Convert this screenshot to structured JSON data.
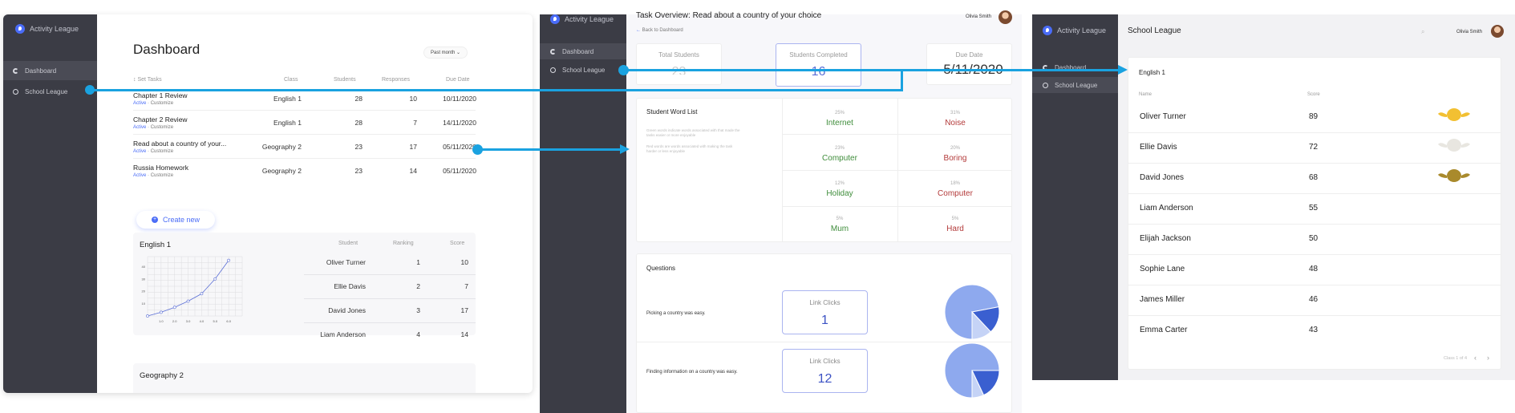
{
  "colors": {
    "accent": "#4a6cf7",
    "sidebar": "#3b3c45",
    "connector": "#1aa2e0",
    "good": "#3f8d3b",
    "bad": "#b33a3a"
  },
  "app": {
    "title": "Activity League"
  },
  "nav": {
    "dashboard": "Dashboard",
    "school_league": "School League"
  },
  "dashboard": {
    "title": "Dashboard",
    "filter": "Past month",
    "columns": {
      "tasks": "Set Tasks",
      "class": "Class",
      "students": "Students",
      "responses": "Responses",
      "due": "Due Date"
    },
    "tasks": [
      {
        "title": "Chapter 1 Review",
        "status": "Active",
        "action": "Customize",
        "class": "English 1",
        "students": "28",
        "responses": "10",
        "due": "10/11/2020"
      },
      {
        "title": "Chapter 2 Review",
        "status": "Active",
        "action": "Customize",
        "class": "English 1",
        "students": "28",
        "responses": "7",
        "due": "14/11/2020"
      },
      {
        "title": "Read about a country of your...",
        "status": "Active",
        "action": "Customize",
        "class": "Geography 2",
        "students": "23",
        "responses": "17",
        "due": "05/11/2020"
      },
      {
        "title": "Russia Homework",
        "status": "Active",
        "action": "Customize",
        "class": "Geography 2",
        "students": "23",
        "responses": "14",
        "due": "05/11/2020"
      }
    ],
    "create_new": "Create new",
    "english_card": {
      "title": "English 1",
      "columns": {
        "student": "Student",
        "ranking": "Ranking",
        "score": "Score"
      },
      "rows": [
        {
          "student": "Oliver Turner",
          "ranking": "1",
          "score": "10"
        },
        {
          "student": "Ellie Davis",
          "ranking": "2",
          "score": "7"
        },
        {
          "student": "David Jones",
          "ranking": "3",
          "score": "17"
        },
        {
          "student": "Liam Anderson",
          "ranking": "4",
          "score": "14"
        }
      ],
      "chart": {
        "x_ticks": [
          "1.0",
          "2.0",
          "3.0",
          "4.0",
          "5.0",
          "6.0"
        ],
        "y_ticks": [
          "10",
          "20",
          "30",
          "40"
        ],
        "points": [
          [
            0,
            0
          ],
          [
            1,
            3
          ],
          [
            2,
            7
          ],
          [
            3,
            12
          ],
          [
            4,
            18
          ],
          [
            5,
            30
          ],
          [
            6,
            45
          ]
        ],
        "xlim": [
          0,
          7
        ],
        "ylim": [
          0,
          48
        ]
      }
    },
    "geography_card": {
      "title": "Geography 2"
    }
  },
  "task_overview": {
    "title": "Task Overview: Read about a country of your choice",
    "back": "Back to Dashboard",
    "user": "Olivia Smith",
    "stats": [
      {
        "label": "Total Students",
        "value": "23"
      },
      {
        "label": "Students Completed",
        "value": "16"
      },
      {
        "label": "Due Date",
        "value": "5/11/2020"
      }
    ],
    "word_list": {
      "title": "Student Word List",
      "desc1": "Green words indicate words associated with that made the tasks easier or more enjoyable",
      "desc2": "Red words are words associated with making the task harder or less enjoyable",
      "good": [
        {
          "pct": "25%",
          "word": "Internet"
        },
        {
          "pct": "23%",
          "word": "Computer"
        },
        {
          "pct": "12%",
          "word": "Holiday"
        },
        {
          "pct": "5%",
          "word": "Mum"
        }
      ],
      "bad": [
        {
          "pct": "31%",
          "word": "Noise"
        },
        {
          "pct": "20%",
          "word": "Boring"
        },
        {
          "pct": "18%",
          "word": "Computer"
        },
        {
          "pct": "5%",
          "word": "Hard"
        }
      ]
    },
    "questions": {
      "title": "Questions",
      "items": [
        {
          "text": "Picking a country was easy.",
          "label": "Link Clicks",
          "value": "1",
          "pie": [
            0.72,
            0.16,
            0.12
          ]
        },
        {
          "text": "Finding information on a country was easy.",
          "label": "Link Clicks",
          "value": "12",
          "pie": [
            0.75,
            0.18,
            0.07
          ]
        }
      ]
    }
  },
  "league": {
    "title": "School League",
    "user": "Olivia Smith",
    "card_title": "English 1",
    "columns": {
      "name": "Name",
      "score": "Score"
    },
    "rows": [
      {
        "name": "Oliver Turner",
        "score": "89",
        "badge": "gold"
      },
      {
        "name": "Ellie Davis",
        "score": "72",
        "badge": "silver"
      },
      {
        "name": "David Jones",
        "score": "68",
        "badge": "bronze"
      },
      {
        "name": "Liam Anderson",
        "score": "55"
      },
      {
        "name": "Elijah Jackson",
        "score": "50"
      },
      {
        "name": "Sophie Lane",
        "score": "48"
      },
      {
        "name": "James Miller",
        "score": "46"
      },
      {
        "name": "Emma Carter",
        "score": "43"
      }
    ],
    "pagination": "Class 1 of 4"
  }
}
